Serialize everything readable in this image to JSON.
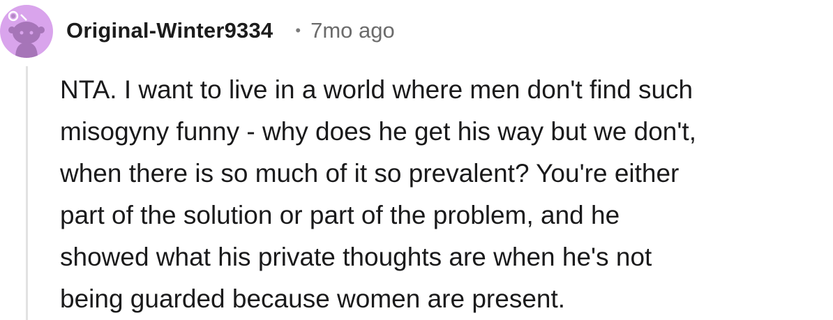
{
  "comment": {
    "author": "Original-Winter9334",
    "separator": "•",
    "timestamp": "7mo ago",
    "avatar_icon": "reddit-snoo-avatar-icon",
    "avatar_color": "#d9a4ec",
    "body_lines": [
      "NTA. I want to live in a world where men don't find such",
      "misogyny funny - why does he get his way but we don't,",
      "when there is so much of it so prevalent? You're either",
      "part of the solution or part of the problem, and he",
      "showed what his private thoughts are when he's not",
      "being guarded because women are present."
    ]
  }
}
